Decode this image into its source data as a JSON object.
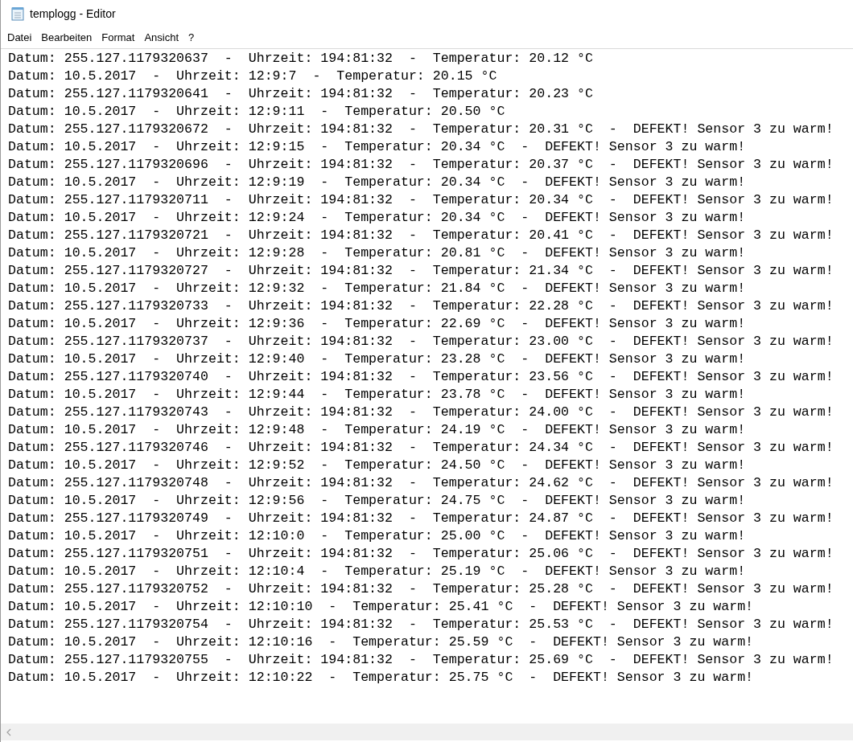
{
  "window": {
    "title": "templogg - Editor"
  },
  "menu": [
    "Datei",
    "Bearbeiten",
    "Format",
    "Ansicht",
    "?"
  ],
  "lines": [
    "Datum: 255.127.1179320637  -  Uhrzeit: 194:81:32  -  Temperatur: 20.12 °C",
    "Datum: 10.5.2017  -  Uhrzeit: 12:9:7  -  Temperatur: 20.15 °C",
    "Datum: 255.127.1179320641  -  Uhrzeit: 194:81:32  -  Temperatur: 20.23 °C",
    "Datum: 10.5.2017  -  Uhrzeit: 12:9:11  -  Temperatur: 20.50 °C",
    "Datum: 255.127.1179320672  -  Uhrzeit: 194:81:32  -  Temperatur: 20.31 °C  -  DEFEKT! Sensor 3 zu warm!",
    "Datum: 10.5.2017  -  Uhrzeit: 12:9:15  -  Temperatur: 20.34 °C  -  DEFEKT! Sensor 3 zu warm!",
    "Datum: 255.127.1179320696  -  Uhrzeit: 194:81:32  -  Temperatur: 20.37 °C  -  DEFEKT! Sensor 3 zu warm!",
    "Datum: 10.5.2017  -  Uhrzeit: 12:9:19  -  Temperatur: 20.34 °C  -  DEFEKT! Sensor 3 zu warm!",
    "Datum: 255.127.1179320711  -  Uhrzeit: 194:81:32  -  Temperatur: 20.34 °C  -  DEFEKT! Sensor 3 zu warm!",
    "Datum: 10.5.2017  -  Uhrzeit: 12:9:24  -  Temperatur: 20.34 °C  -  DEFEKT! Sensor 3 zu warm!",
    "Datum: 255.127.1179320721  -  Uhrzeit: 194:81:32  -  Temperatur: 20.41 °C  -  DEFEKT! Sensor 3 zu warm!",
    "Datum: 10.5.2017  -  Uhrzeit: 12:9:28  -  Temperatur: 20.81 °C  -  DEFEKT! Sensor 3 zu warm!",
    "Datum: 255.127.1179320727  -  Uhrzeit: 194:81:32  -  Temperatur: 21.34 °C  -  DEFEKT! Sensor 3 zu warm!",
    "Datum: 10.5.2017  -  Uhrzeit: 12:9:32  -  Temperatur: 21.84 °C  -  DEFEKT! Sensor 3 zu warm!",
    "Datum: 255.127.1179320733  -  Uhrzeit: 194:81:32  -  Temperatur: 22.28 °C  -  DEFEKT! Sensor 3 zu warm!",
    "Datum: 10.5.2017  -  Uhrzeit: 12:9:36  -  Temperatur: 22.69 °C  -  DEFEKT! Sensor 3 zu warm!",
    "Datum: 255.127.1179320737  -  Uhrzeit: 194:81:32  -  Temperatur: 23.00 °C  -  DEFEKT! Sensor 3 zu warm!",
    "Datum: 10.5.2017  -  Uhrzeit: 12:9:40  -  Temperatur: 23.28 °C  -  DEFEKT! Sensor 3 zu warm!",
    "Datum: 255.127.1179320740  -  Uhrzeit: 194:81:32  -  Temperatur: 23.56 °C  -  DEFEKT! Sensor 3 zu warm!",
    "Datum: 10.5.2017  -  Uhrzeit: 12:9:44  -  Temperatur: 23.78 °C  -  DEFEKT! Sensor 3 zu warm!",
    "Datum: 255.127.1179320743  -  Uhrzeit: 194:81:32  -  Temperatur: 24.00 °C  -  DEFEKT! Sensor 3 zu warm!",
    "Datum: 10.5.2017  -  Uhrzeit: 12:9:48  -  Temperatur: 24.19 °C  -  DEFEKT! Sensor 3 zu warm!",
    "Datum: 255.127.1179320746  -  Uhrzeit: 194:81:32  -  Temperatur: 24.34 °C  -  DEFEKT! Sensor 3 zu warm!",
    "Datum: 10.5.2017  -  Uhrzeit: 12:9:52  -  Temperatur: 24.50 °C  -  DEFEKT! Sensor 3 zu warm!",
    "Datum: 255.127.1179320748  -  Uhrzeit: 194:81:32  -  Temperatur: 24.62 °C  -  DEFEKT! Sensor 3 zu warm!",
    "Datum: 10.5.2017  -  Uhrzeit: 12:9:56  -  Temperatur: 24.75 °C  -  DEFEKT! Sensor 3 zu warm!",
    "Datum: 255.127.1179320749  -  Uhrzeit: 194:81:32  -  Temperatur: 24.87 °C  -  DEFEKT! Sensor 3 zu warm!",
    "Datum: 10.5.2017  -  Uhrzeit: 12:10:0  -  Temperatur: 25.00 °C  -  DEFEKT! Sensor 3 zu warm!",
    "Datum: 255.127.1179320751  -  Uhrzeit: 194:81:32  -  Temperatur: 25.06 °C  -  DEFEKT! Sensor 3 zu warm!",
    "Datum: 10.5.2017  -  Uhrzeit: 12:10:4  -  Temperatur: 25.19 °C  -  DEFEKT! Sensor 3 zu warm!",
    "Datum: 255.127.1179320752  -  Uhrzeit: 194:81:32  -  Temperatur: 25.28 °C  -  DEFEKT! Sensor 3 zu warm!",
    "Datum: 10.5.2017  -  Uhrzeit: 12:10:10  -  Temperatur: 25.41 °C  -  DEFEKT! Sensor 3 zu warm!",
    "Datum: 255.127.1179320754  -  Uhrzeit: 194:81:32  -  Temperatur: 25.53 °C  -  DEFEKT! Sensor 3 zu warm!",
    "Datum: 10.5.2017  -  Uhrzeit: 12:10:16  -  Temperatur: 25.59 °C  -  DEFEKT! Sensor 3 zu warm!",
    "Datum: 255.127.1179320755  -  Uhrzeit: 194:81:32  -  Temperatur: 25.69 °C  -  DEFEKT! Sensor 3 zu warm!",
    "Datum: 10.5.2017  -  Uhrzeit: 12:10:22  -  Temperatur: 25.75 °C  -  DEFEKT! Sensor 3 zu warm!"
  ]
}
